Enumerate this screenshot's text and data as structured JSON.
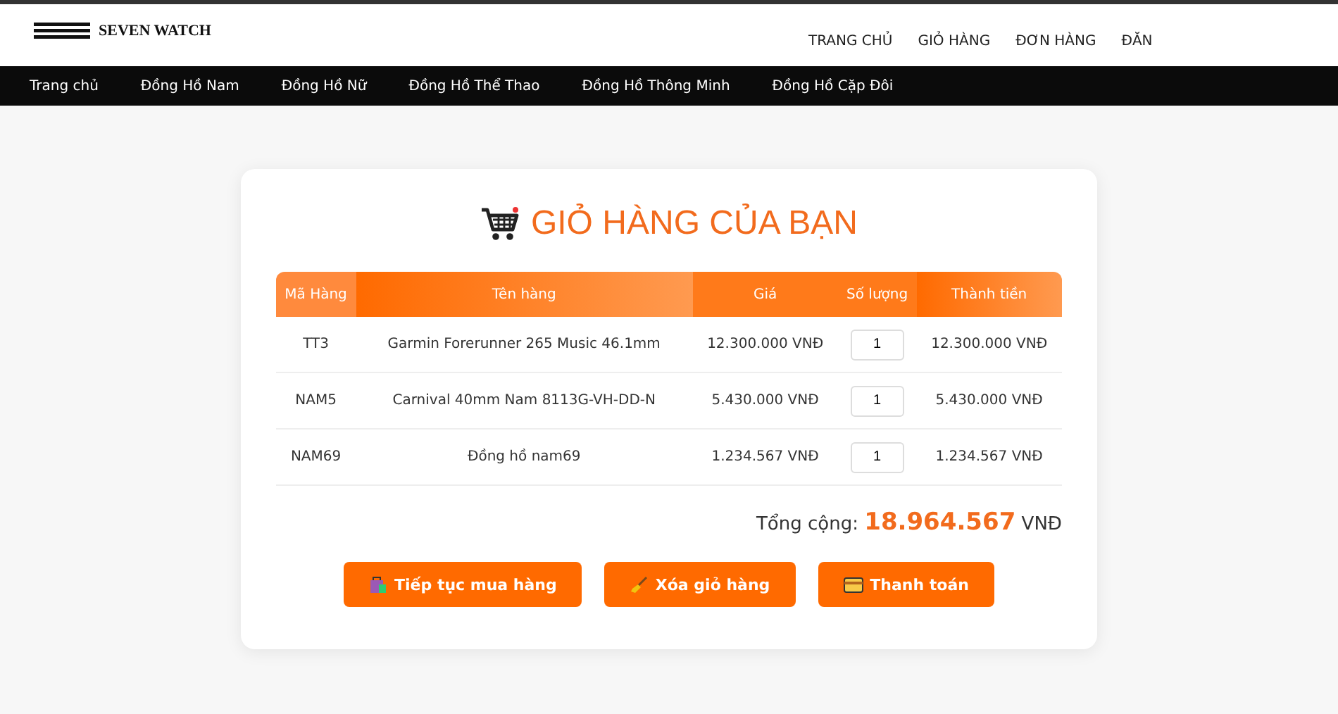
{
  "header": {
    "brand": "SEVEN WATCH",
    "nav": [
      "TRANG CHỦ",
      "GIỎ HÀNG",
      "ĐƠN HÀNG",
      "ĐĂN"
    ]
  },
  "category_bar": [
    "Trang chủ",
    "Đồng Hồ Nam",
    "Đồng Hồ Nữ",
    "Đồng Hồ Thể Thao",
    "Đồng Hồ Thông Minh",
    "Đồng Hồ Cặp Đôi"
  ],
  "cart": {
    "title": "GIỎ HÀNG CỦA BẠN",
    "table": {
      "columns": [
        "Mã Hàng",
        "Tên hàng",
        "Giá",
        "Số lượng",
        "Thành tiền"
      ],
      "rows": [
        {
          "code": "TT3",
          "name": "Garmin Forerunner 265 Music 46.1mm",
          "price": "12.300.000 VNĐ",
          "quantity": "1",
          "subtotal": "12.300.000 VNĐ"
        },
        {
          "code": "NAM5",
          "name": "Carnival 40mm Nam 8113G-VH-DD-N",
          "price": "5.430.000 VNĐ",
          "quantity": "1",
          "subtotal": "5.430.000 VNĐ"
        },
        {
          "code": "NAM69",
          "name": "Đồng hồ nam69",
          "price": "1.234.567 VNĐ",
          "quantity": "1",
          "subtotal": "1.234.567 VNĐ"
        }
      ]
    },
    "total": {
      "label": "Tổng cộng:",
      "amount": "18.964.567",
      "currency": "VNĐ"
    },
    "buttons": [
      {
        "kind": "shop",
        "label": "Tiếp tục mua hàng"
      },
      {
        "kind": "clear",
        "label": "Xóa giỏ hàng"
      },
      {
        "kind": "pay",
        "label": "Thanh toán"
      }
    ]
  }
}
